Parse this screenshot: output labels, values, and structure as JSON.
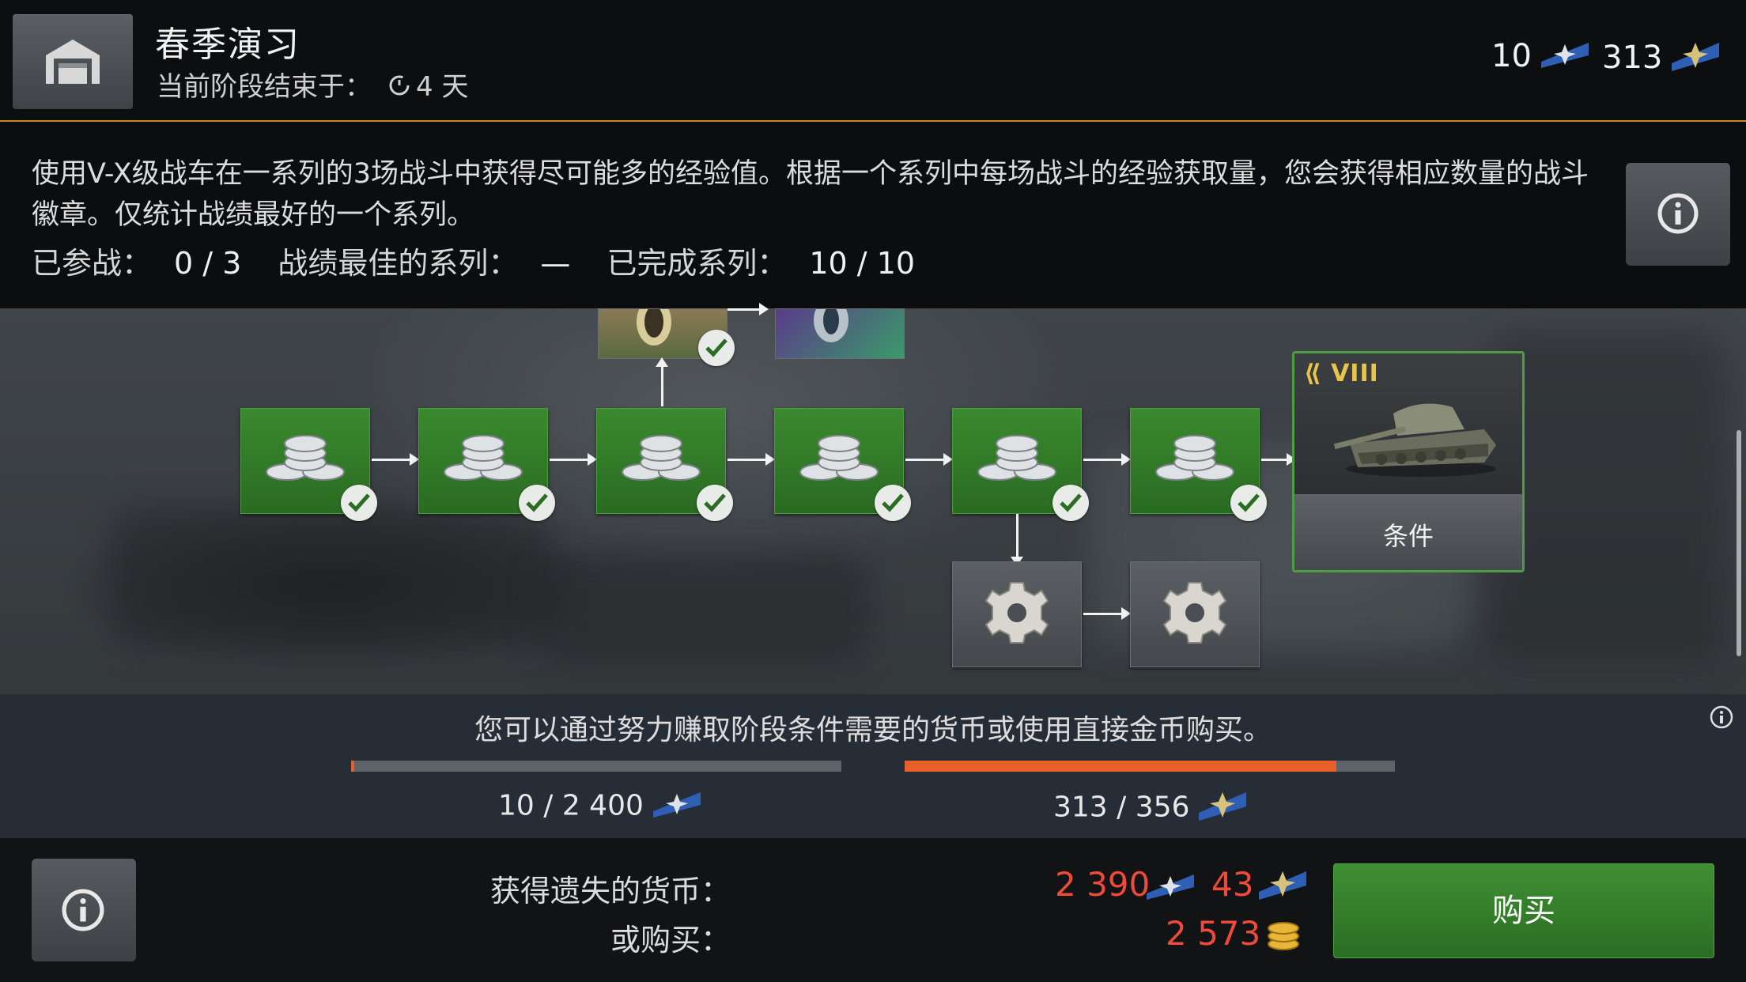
{
  "header": {
    "title": "春季演习",
    "subtitle_label": "当前阶段结束于：",
    "time_left": "4 天",
    "currency_a": "10",
    "currency_b": "313"
  },
  "description": {
    "text": "使用V-X级战车在一系列的3场战斗中获得尽可能多的经验值。根据一个系列中每场战斗的经验获取量，您会获得相应数量的战斗徽章。仅统计战绩最好的一个系列。",
    "stats": {
      "played_label": "已参战：",
      "played_value": "0 / 3",
      "best_label": "战绩最佳的系列：",
      "best_value": "—",
      "done_label": "已完成系列：",
      "done_value": "10 / 10"
    }
  },
  "graph": {
    "reward_card_tier": "VIII",
    "reward_card_label": "条件"
  },
  "progress": {
    "title": "您可以通过努力赚取阶段条件需要的货币或使用直接金币购买。",
    "bar1": {
      "text": "10 / 2 400",
      "fraction": 0.004
    },
    "bar2": {
      "text": "313 / 356",
      "fraction": 0.88
    }
  },
  "bottom": {
    "lost_label": "获得遗失的货币：",
    "lost_amount_a": "2 390",
    "lost_amount_b": "43",
    "buy_label": "或购买：",
    "gold_amount": "2 573",
    "buy_button": "购买"
  },
  "colors": {
    "accent_orange": "#e8612a",
    "node_green": "#2f7a26",
    "price_red": "#f04a3a",
    "header_line": "#c88a1e"
  }
}
